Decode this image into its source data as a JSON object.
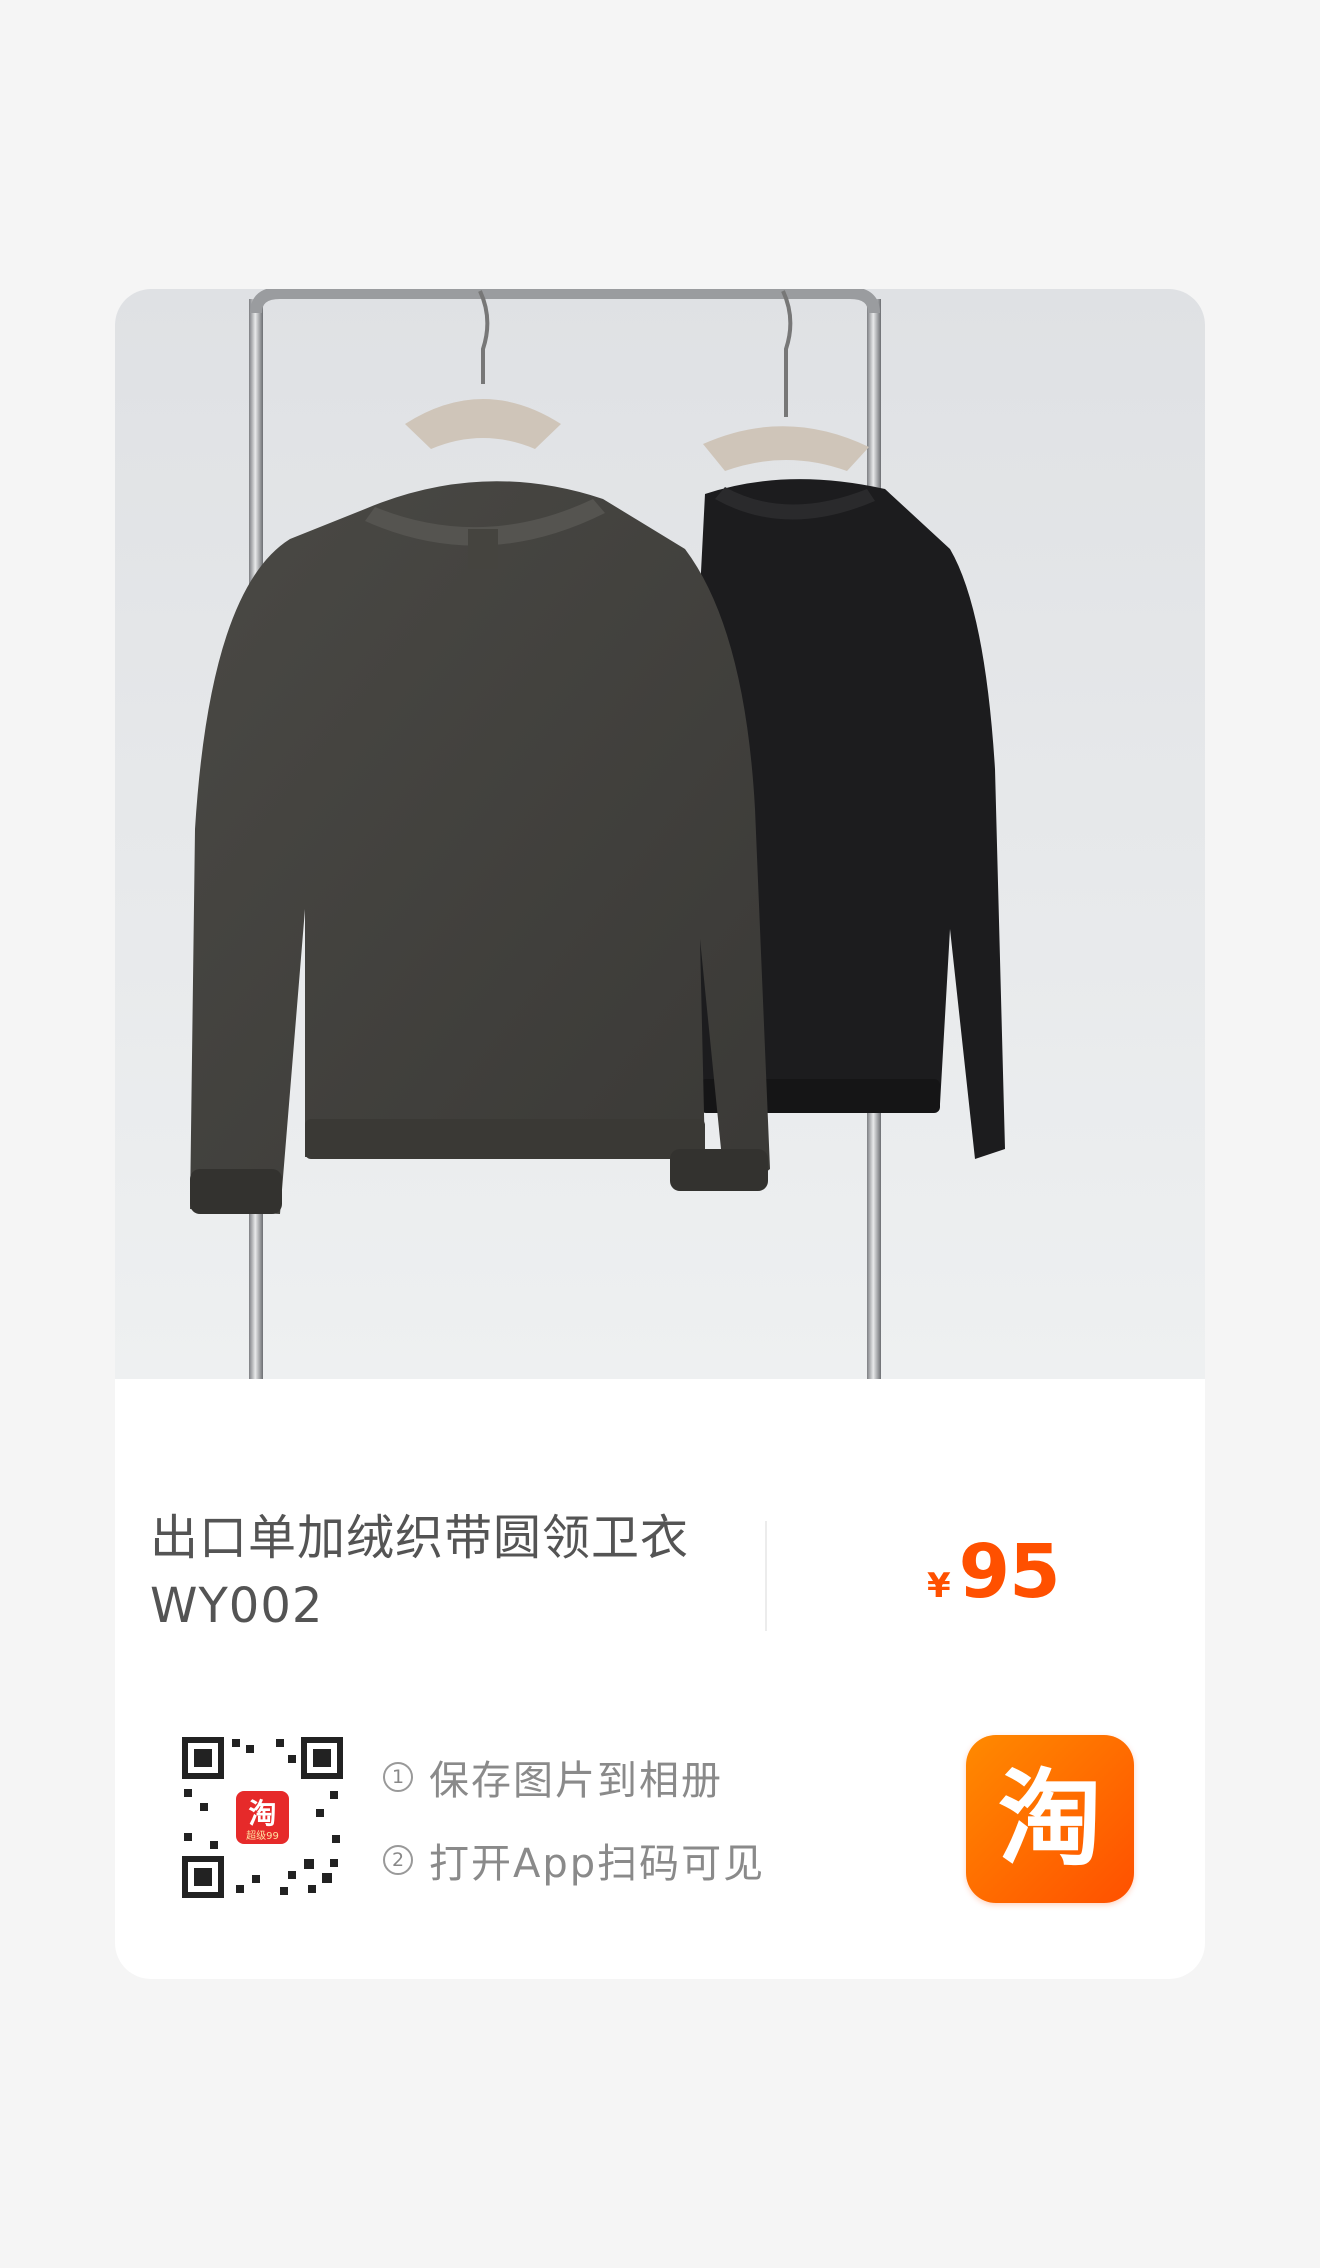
{
  "product": {
    "title_line1": "出口单加绒织带圆领卫衣",
    "title_line2": "WY002",
    "currency": "¥",
    "price": "95"
  },
  "qr_badge": {
    "app_glyph": "淘",
    "caption": "超级99"
  },
  "instructions": [
    {
      "num": "1",
      "text": "保存图片到相册"
    },
    {
      "num": "2",
      "text": "打开App扫码可见"
    }
  ],
  "app_logo": {
    "glyph": "淘",
    "icon": "taobao-logo-icon",
    "color": "#ff5000"
  },
  "colors": {
    "accent": "#ff5000",
    "text": "#545454",
    "muted": "#8a8a8a",
    "background": "#f5f5f5"
  }
}
